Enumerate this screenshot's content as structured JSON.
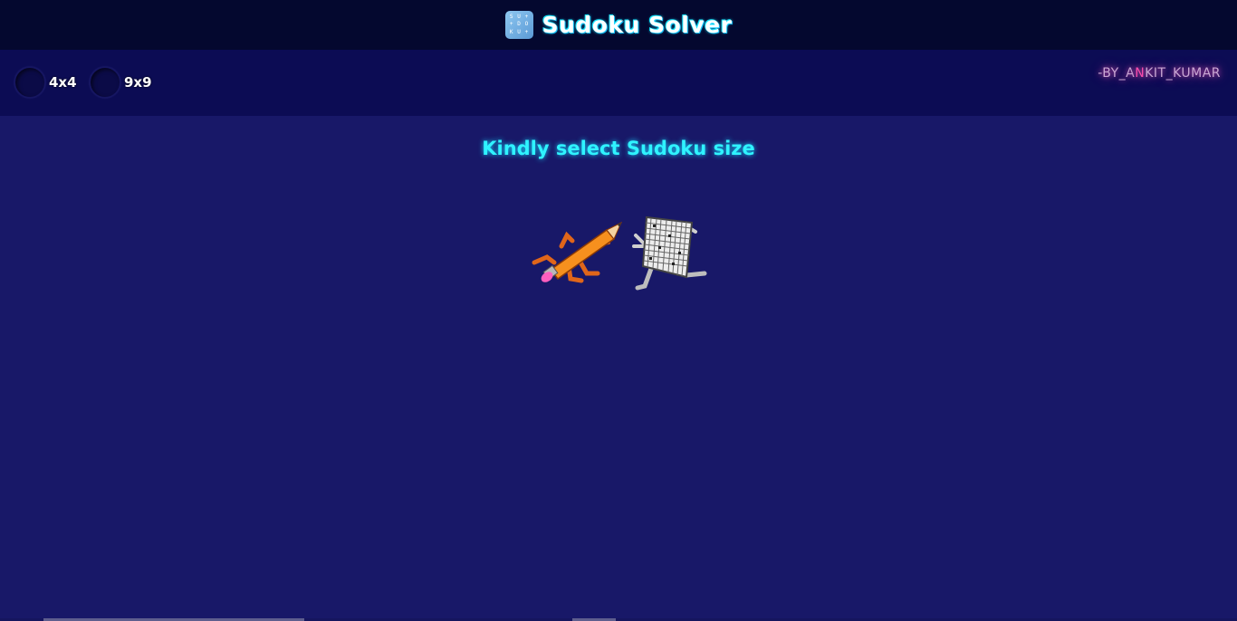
{
  "header": {
    "title": "Sudoku Solver",
    "logo_letters": [
      "S",
      "U",
      "+",
      "+",
      "D",
      "O",
      "K",
      "U",
      "+"
    ]
  },
  "options": {
    "size_4": "4x4",
    "size_9": "9x9"
  },
  "author": {
    "prefix": "-BY_A",
    "highlight": "N",
    "suffix": "KIT_KUMAR"
  },
  "main": {
    "message": "Kindly select Sudoku size"
  },
  "colors": {
    "accent": "#2ff3ff",
    "background": "#181868",
    "header": "#04082f"
  }
}
